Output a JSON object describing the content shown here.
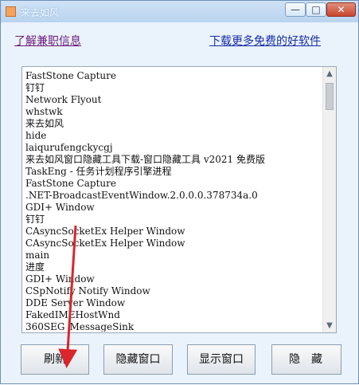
{
  "window": {
    "title": "来去如风",
    "controls": {
      "minimize": "—",
      "maximize": "□",
      "close": "✕"
    }
  },
  "links": {
    "left": "了解兼职信息",
    "right": "下载更多免费的好软件"
  },
  "window_list": {
    "items": [
      "FastStone Capture",
      "钉钉",
      "Network Flyout",
      "whstwk",
      "来去如风",
      "hide",
      "laiqurufengckycgj",
      "来去如风窗口隐藏工具下载-窗口隐藏工具 v2021 免费版",
      "TaskEng - 任务计划程序引擎进程",
      "FastStone Capture",
      ".NET-BroadcastEventWindow.2.0.0.0.378734a.0",
      "GDI+ Window",
      "钉钉",
      "CAsyncSocketEx Helper Window",
      "CAsyncSocketEx Helper Window",
      "main",
      "进度",
      "GDI+ Window",
      "CSpNotify Notify Window",
      "DDE Server Window",
      "FakedIMEHostWnd",
      "360SEG_MessageSink"
    ]
  },
  "scrollbar": {
    "up": "▲",
    "down": "▼"
  },
  "buttons": {
    "refresh": "刷新",
    "hide_window": "隐藏窗口",
    "show_window": "显示窗口",
    "hide": "隐藏"
  },
  "colors": {
    "window_bg": "#eaf2fb",
    "link_visited": "#6b1d7a",
    "link": "#172ea6",
    "annotation_arrow": "#d9262b"
  }
}
